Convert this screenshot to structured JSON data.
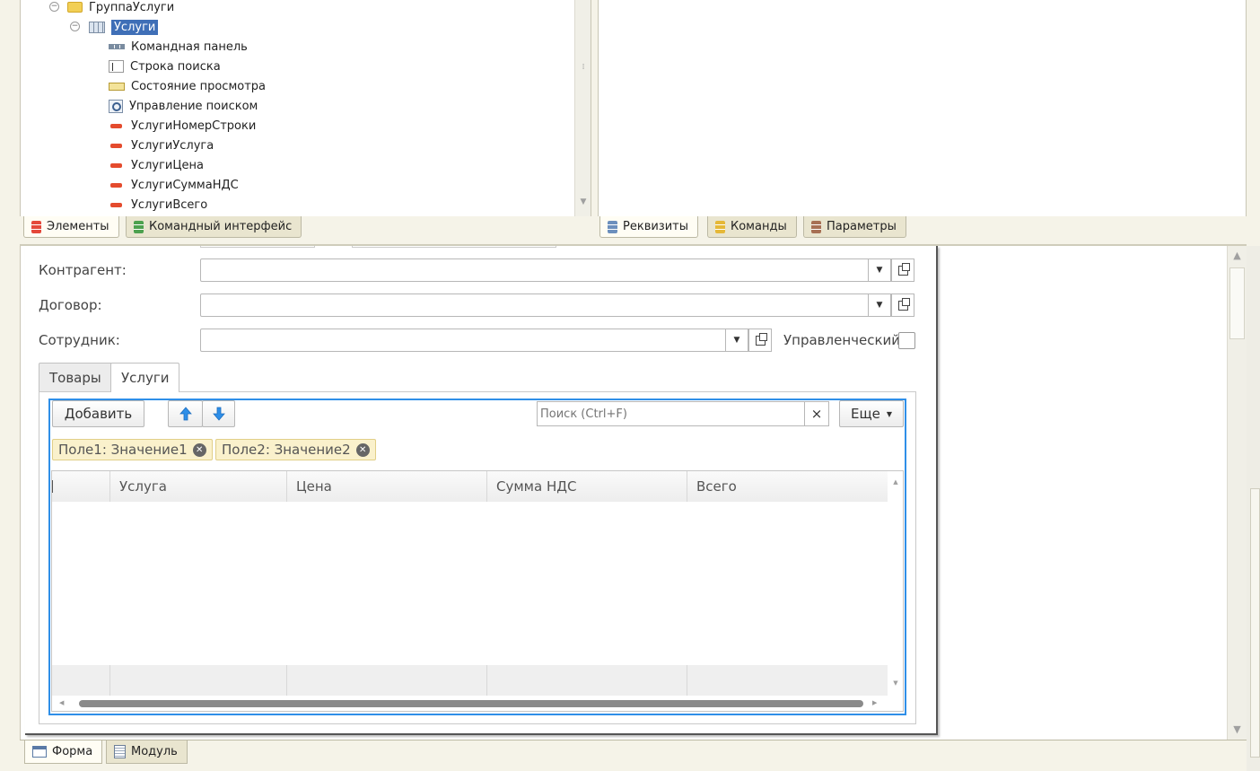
{
  "tree": {
    "items": [
      {
        "label": "ГруппаУслуги",
        "icon": "folder-icon"
      },
      {
        "label": "Услуги",
        "icon": "table-icon"
      },
      {
        "label": "Командная панель",
        "icon": "command-panel-icon"
      },
      {
        "label": "Строка поиска",
        "icon": "search-line-icon"
      },
      {
        "label": "Состояние просмотра",
        "icon": "view-state-icon"
      },
      {
        "label": "Управление поиском",
        "icon": "search-control-icon"
      },
      {
        "label": "УслугиНомерСтроки",
        "icon": "field-icon"
      },
      {
        "label": "УслугиУслуга",
        "icon": "field-icon"
      },
      {
        "label": "УслугиЦена",
        "icon": "field-icon"
      },
      {
        "label": "УслугиСуммаНДС",
        "icon": "field-icon"
      },
      {
        "label": "УслугиВсего",
        "icon": "field-icon"
      }
    ]
  },
  "left_tabs": [
    "Элементы",
    "Командный интерфейс"
  ],
  "right_tabs": [
    "Реквизиты",
    "Команды",
    "Параметры"
  ],
  "form": {
    "contractor_label": "Контрагент:",
    "contract_label": "Договор:",
    "employee_label": "Сотрудник:",
    "managerial_label": "Управленческий:",
    "tabs": [
      "Товары",
      "Услуги"
    ],
    "add_button": "Добавить",
    "search_placeholder": "Поиск (Ctrl+F)",
    "more_button": "Еще",
    "chips": [
      "Поле1: Значение1",
      "Поле2: Значение2"
    ],
    "columns": [
      "Услуга",
      "Цена",
      "Сумма НДС",
      "Всего"
    ]
  },
  "bottom_tabs": [
    "Форма",
    "Модуль"
  ],
  "colors": {
    "selection": "#3f6fb7",
    "focus_frame": "#2f8fe8",
    "chip_bg": "#faf1cc"
  }
}
